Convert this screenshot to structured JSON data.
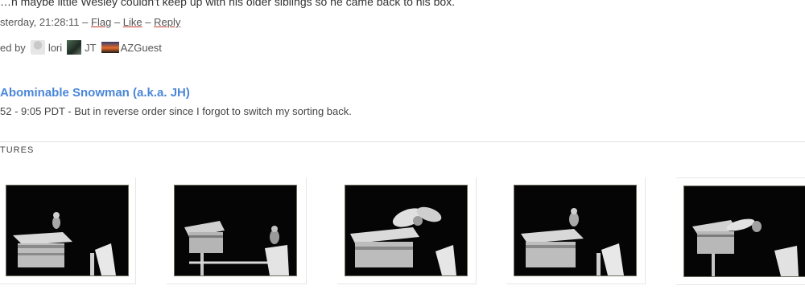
{
  "comment": {
    "body": "…n maybe little Wesley couldn't keep up with his older siblings so he came back to his box.",
    "time": "sterday, 21:28:11",
    "sep": "–",
    "actions": [
      "Flag",
      "Like",
      "Reply"
    ],
    "liked_by_label": "ed by",
    "likers": [
      {
        "name": "lori",
        "icon": "gray-avatar-icon"
      },
      {
        "name": "JT",
        "icon": "photo-avatar-icon"
      },
      {
        "name": "AZGuest",
        "icon": "sunset-avatar-icon"
      }
    ]
  },
  "post": {
    "author": "Abominable Snowman (a.k.a. JH)",
    "meta": "52 - 9:05 PDT -  But in reverse order since I forgot to switch my sorting back."
  },
  "pictures": {
    "heading": "TURES",
    "items": [
      {
        "alt": "owl-on-box-roof",
        "icon": "owl-photo-1"
      },
      {
        "alt": "owl-on-perch",
        "icon": "owl-photo-2"
      },
      {
        "alt": "owl-wings-spread",
        "icon": "owl-photo-3"
      },
      {
        "alt": "owl-on-box-roof-2",
        "icon": "owl-photo-4"
      },
      {
        "alt": "owl-flying",
        "icon": "owl-photo-5"
      }
    ]
  }
}
